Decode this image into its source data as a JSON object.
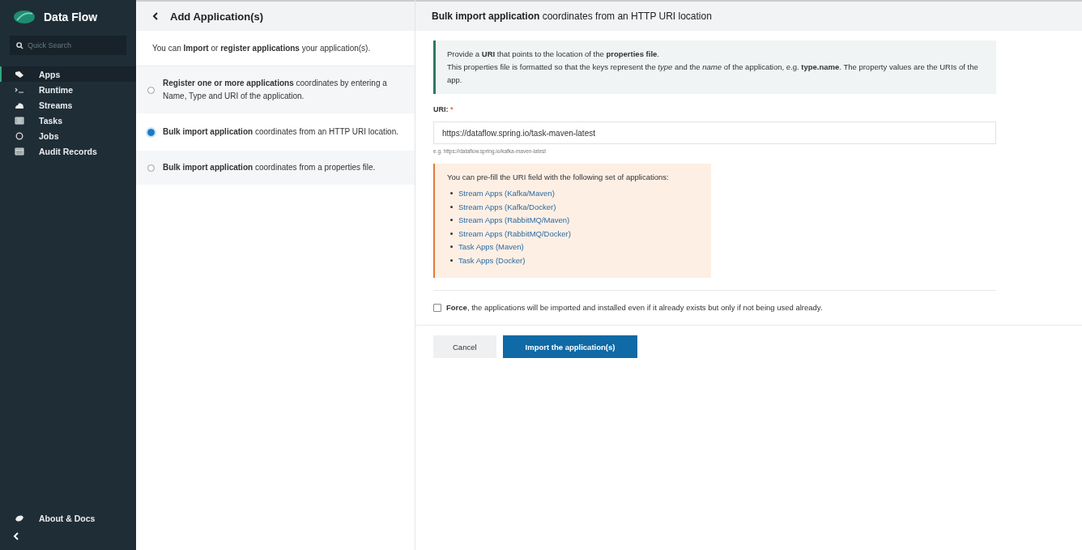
{
  "sidebar": {
    "title": "Data Flow",
    "search": {
      "placeholder": "Quick Search"
    },
    "items": [
      {
        "label": "Apps",
        "kind": "tag",
        "selected": true
      },
      {
        "label": "Runtime",
        "kind": "terminal",
        "selected": false
      },
      {
        "label": "Streams",
        "kind": "cloud",
        "selected": false
      },
      {
        "label": "Tasks",
        "kind": "list",
        "selected": false
      },
      {
        "label": "Jobs",
        "kind": "clock",
        "selected": false
      },
      {
        "label": "Audit Records",
        "kind": "table",
        "selected": false
      }
    ],
    "footer": {
      "label": "About & Docs"
    }
  },
  "panel": {
    "title": "Add Application(s)",
    "intro": "You can **Import** or **register applications** your application(s).",
    "options": [
      {
        "text": "**Register one or more applications** coordinates by entering a Name, Type and URI of the application.",
        "selected": false
      },
      {
        "text": "**Bulk import application** coordinates from an HTTP URI location.",
        "selected": true
      },
      {
        "text": "**Bulk import application** coordinates from a properties file.",
        "selected": false
      }
    ]
  },
  "form": {
    "title": "**Bulk import application** coordinates from an HTTP URI location",
    "info": [
      "Provide a **URI** that points to the location of the **properties file**.",
      "This properties file is formatted so that the keys represent the *type* and the *name* of the application, e.g. **type.name**. The property values are the URIs of the app."
    ],
    "uri_label": "URI:",
    "required_mark": "*",
    "uri_value": "https://dataflow.spring.io/task-maven-latest",
    "uri_hint": "e.g. https://dataflow.spring.io/kafka-maven-latest",
    "prefill": {
      "text": "You can pre-fill the URI field with the following set of applications:",
      "links": [
        "Stream Apps (Kafka/Maven)",
        "Stream Apps (Kafka/Docker)",
        "Stream Apps (RabbitMQ/Maven)",
        "Stream Apps (RabbitMQ/Docker)",
        "Task Apps (Maven)",
        "Task Apps (Docker)"
      ]
    },
    "force": {
      "text": "**Force**, the applications will be imported and installed even if it already exists but only if not being used already.",
      "checked": false
    },
    "buttons": [
      {
        "label": "Cancel",
        "kind": "secondary"
      },
      {
        "label": "Import the application(s)",
        "kind": "primary"
      }
    ]
  }
}
